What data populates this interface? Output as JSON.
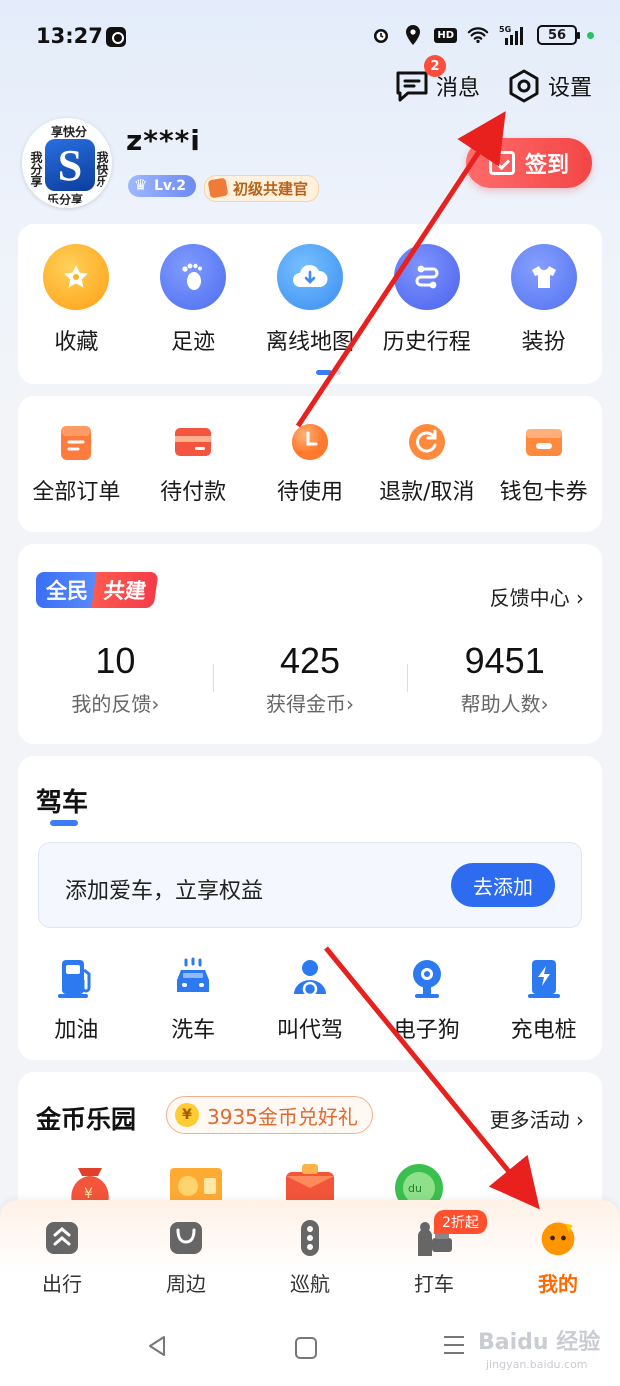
{
  "status_bar": {
    "time": "13:27",
    "network": "5G",
    "hd": "HD",
    "battery": "56"
  },
  "header": {
    "messages_label": "消息",
    "messages_badge": "2",
    "settings_label": "设置"
  },
  "profile": {
    "avatar_logo": "S",
    "avatar_text": [
      "享快分",
      "我分享",
      "我快乐",
      "乐分享"
    ],
    "username": "z***i",
    "level": "Lv.2",
    "title_badge": "初级共建官",
    "signin_label": "签到"
  },
  "shortcuts": [
    {
      "label": "收藏",
      "icon": "star-icon",
      "color": "#ffb21f"
    },
    {
      "label": "足迹",
      "icon": "footprint-icon",
      "color": "#5a7cf5"
    },
    {
      "label": "离线地图",
      "icon": "cloud-download-icon",
      "color": "#4f9cf7"
    },
    {
      "label": "历史行程",
      "icon": "route-icon",
      "color": "#5a73f2"
    },
    {
      "label": "装扮",
      "icon": "tshirt-icon",
      "color": "#5d7ff6"
    }
  ],
  "orders": [
    {
      "label": "全部订单",
      "icon": "order-icon",
      "color": "#ff7a3d"
    },
    {
      "label": "待付款",
      "icon": "card-icon",
      "color": "#f4553f"
    },
    {
      "label": "待使用",
      "icon": "clock-icon",
      "color": "#ff8a3d"
    },
    {
      "label": "退款/取消",
      "icon": "refund-icon",
      "color": "#ff8a3d"
    },
    {
      "label": "钱包卡券",
      "icon": "wallet-icon",
      "color": "#ff8a3d"
    }
  ],
  "community": {
    "tag_a": "全民",
    "tag_b": "共建",
    "feedback_center": "反馈中心 ›",
    "stats": [
      {
        "value": "10",
        "label": "我的反馈›"
      },
      {
        "value": "425",
        "label": "获得金币›"
      },
      {
        "value": "9451",
        "label": "帮助人数›"
      }
    ]
  },
  "driving": {
    "title": "驾车",
    "add_car_text": "添加爱车，立享权益",
    "add_car_button": "去添加",
    "services": [
      {
        "label": "加油",
        "icon": "fuel-icon"
      },
      {
        "label": "洗车",
        "icon": "car-wash-icon"
      },
      {
        "label": "叫代驾",
        "icon": "driver-icon"
      },
      {
        "label": "电子狗",
        "icon": "radar-icon"
      },
      {
        "label": "充电桩",
        "icon": "charging-icon"
      }
    ]
  },
  "coins": {
    "title": "金币乐园",
    "coin_symbol": "¥",
    "pill": "3935金币兑好礼",
    "more": "更多活动 ›"
  },
  "tabbar": [
    {
      "label": "出行",
      "icon": "travel-icon",
      "active": false
    },
    {
      "label": "周边",
      "icon": "nearby-bag-icon",
      "active": false
    },
    {
      "label": "巡航",
      "icon": "cruise-icon",
      "active": false
    },
    {
      "label": "打车",
      "icon": "taxi-icon",
      "active": false,
      "badge": "2折起"
    },
    {
      "label": "我的",
      "icon": "profile-face-icon",
      "active": true
    }
  ],
  "watermark": {
    "main": "Baidu 经验",
    "sub": "jingyan.baidu.com"
  },
  "colors": {
    "accent": "#2d6cf0",
    "active_tab": "#ff6a00",
    "annotation": "#e8201e"
  }
}
